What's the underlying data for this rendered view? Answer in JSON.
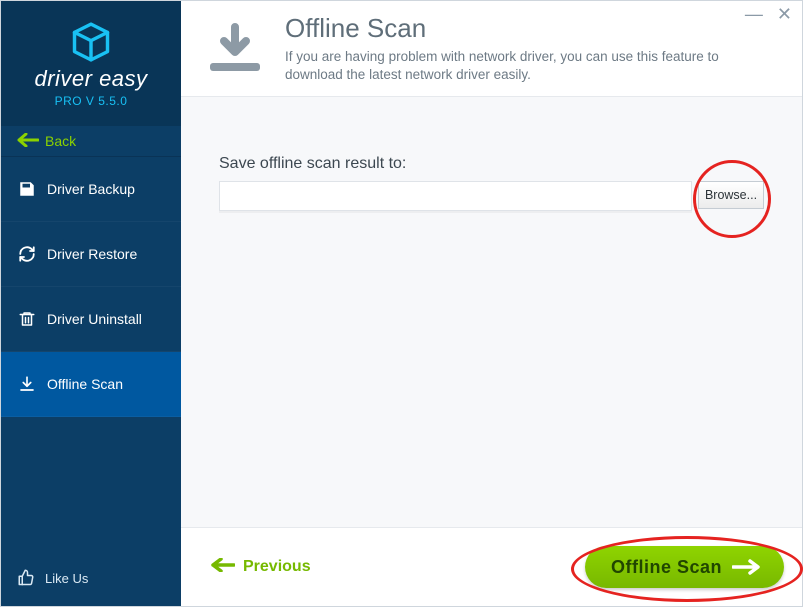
{
  "brand": {
    "name": "driver easy",
    "version_line": "PRO V 5.5.0"
  },
  "sidebar": {
    "back_label": "Back",
    "items": [
      {
        "label": "Driver Backup"
      },
      {
        "label": "Driver Restore"
      },
      {
        "label": "Driver Uninstall"
      },
      {
        "label": "Offline Scan"
      }
    ],
    "like_label": "Like Us"
  },
  "header": {
    "title": "Offline Scan",
    "subtitle": "If you are having problem with network driver, you can use this feature to download the latest network driver easily."
  },
  "form": {
    "save_label": "Save offline scan result to:",
    "path_value": "",
    "browse_label": "Browse..."
  },
  "footer": {
    "prev_label": "Previous",
    "scan_label": "Offline Scan"
  }
}
